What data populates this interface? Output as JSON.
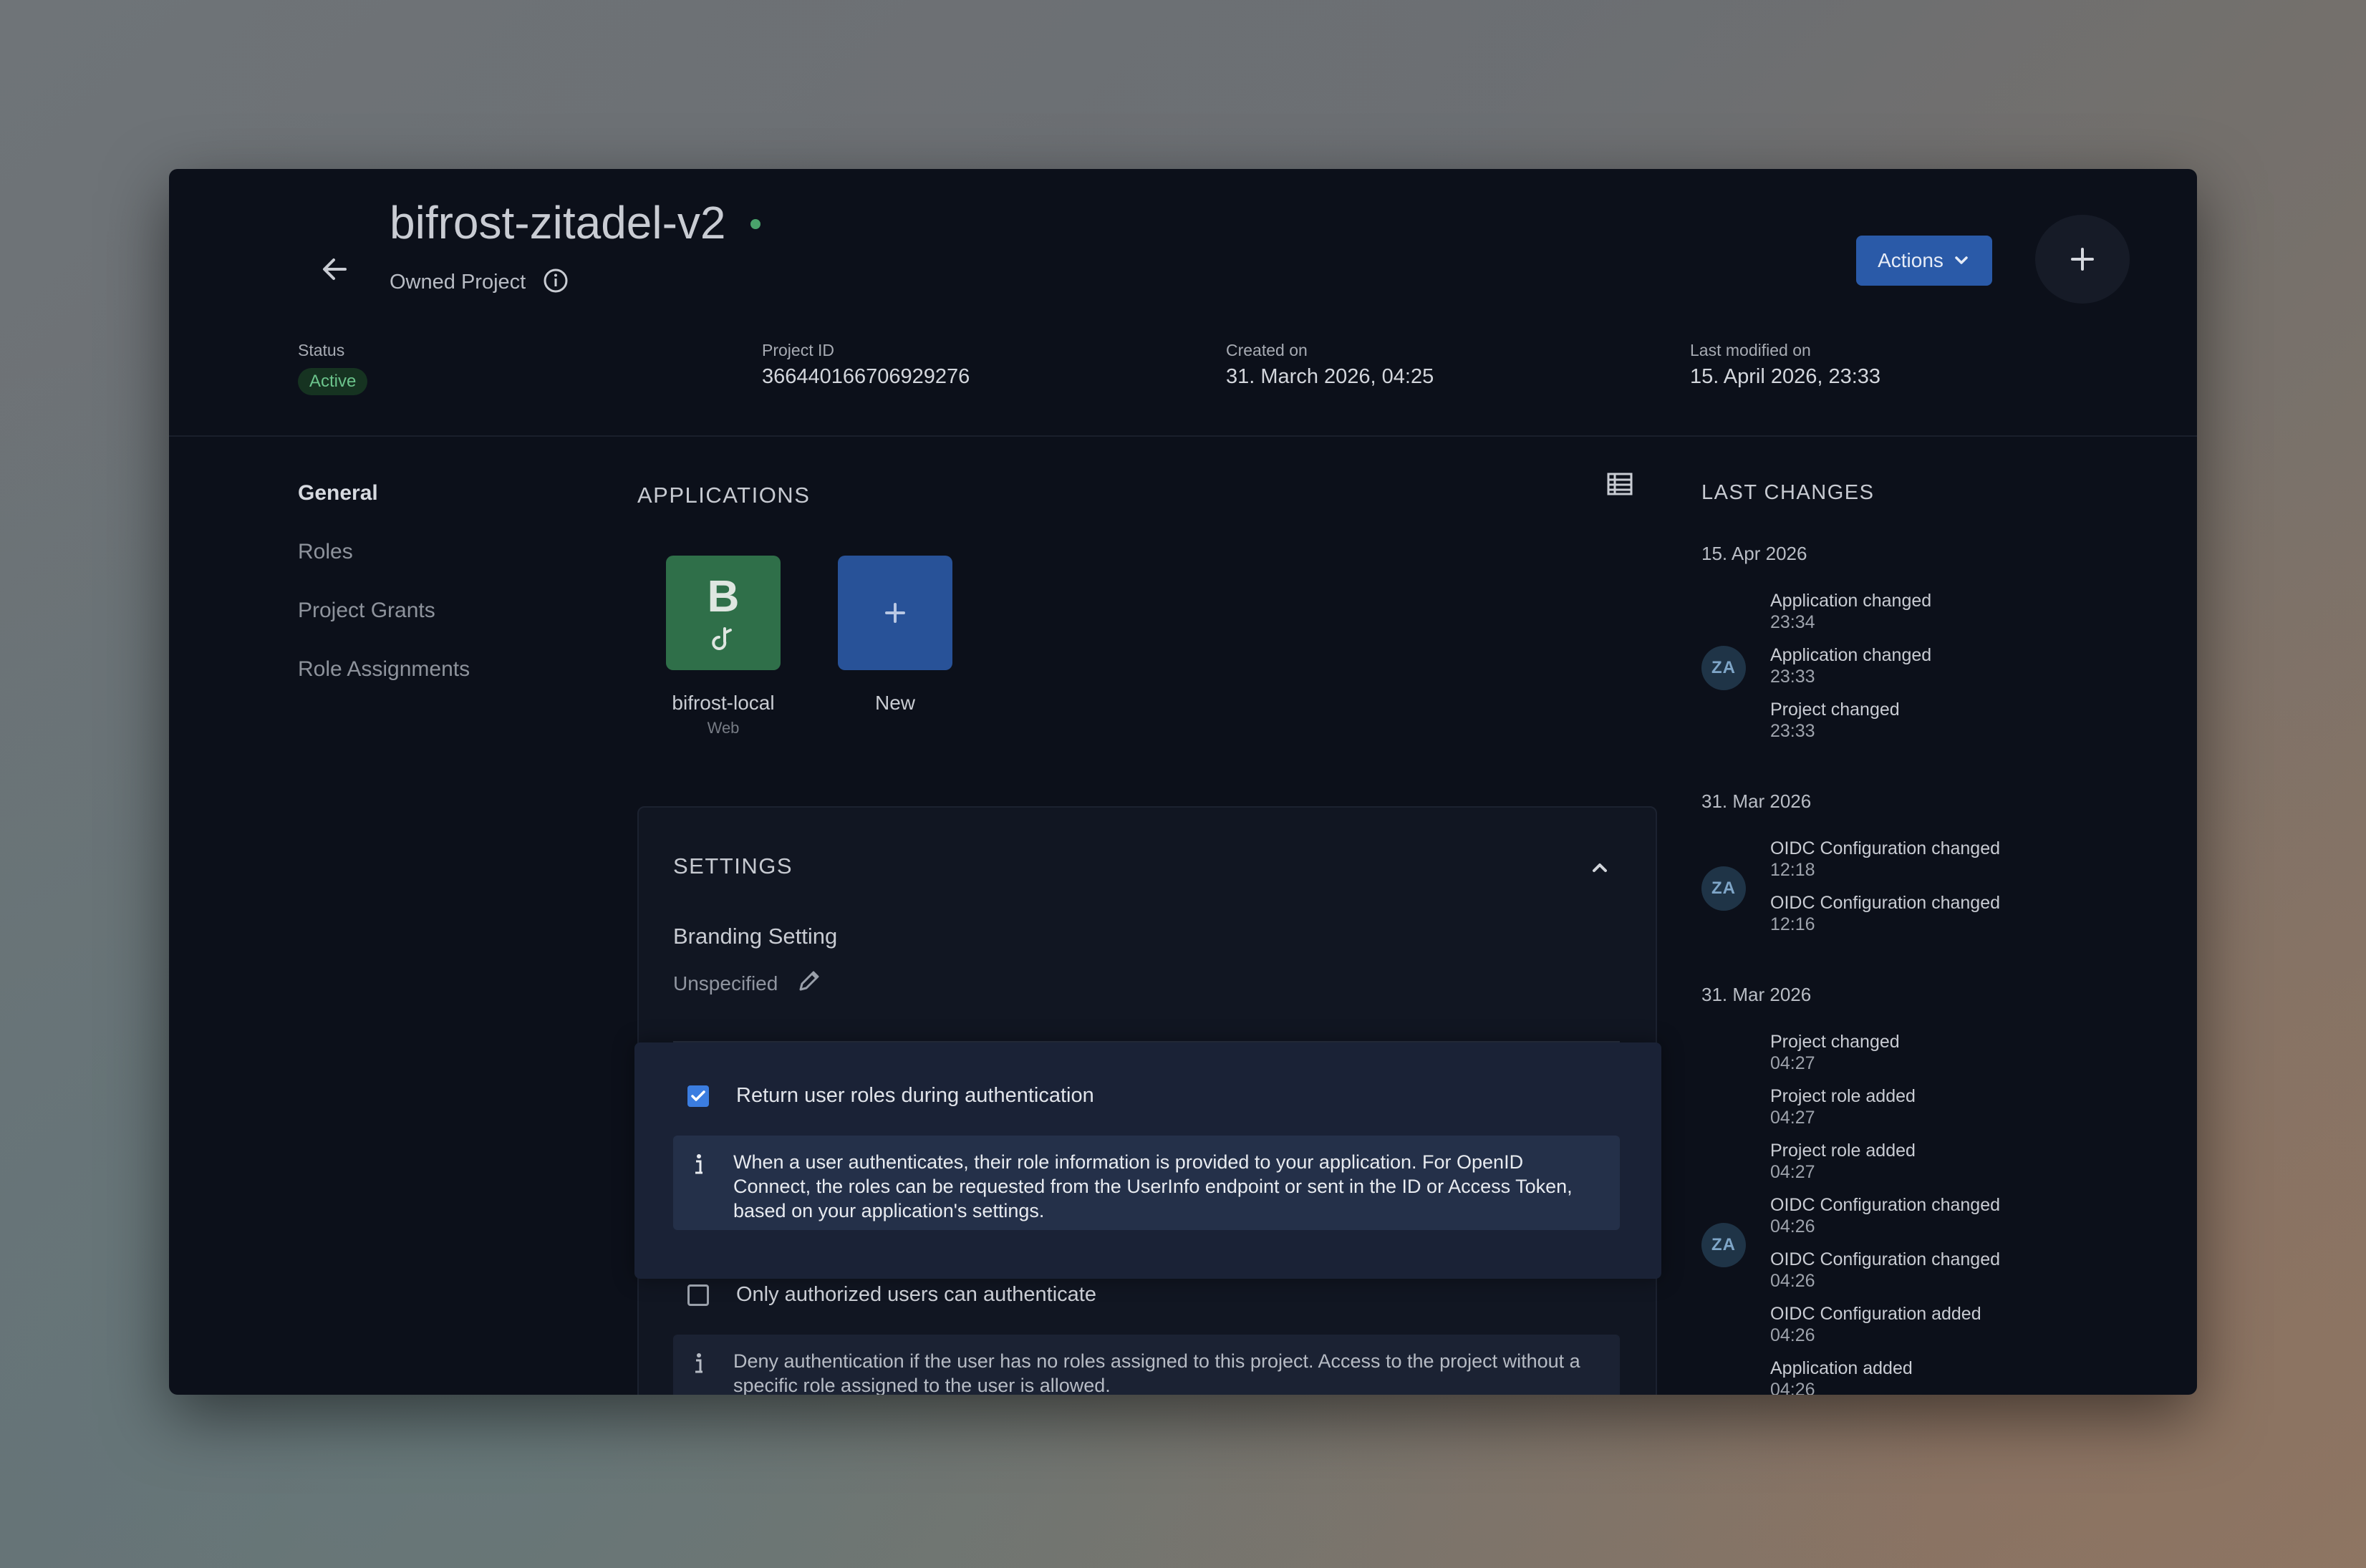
{
  "header": {
    "title": "bifrost-zitadel-v2",
    "subtitle": "Owned Project",
    "actions_label": "Actions"
  },
  "meta": {
    "status_label": "Status",
    "status_value": "Active",
    "project_id_label": "Project ID",
    "project_id_value": "366440166706929276",
    "created_label": "Created on",
    "created_value": "31. March 2026, 04:25",
    "modified_label": "Last modified on",
    "modified_value": "15. April 2026, 23:33"
  },
  "nav": {
    "items": [
      "General",
      "Roles",
      "Project Grants",
      "Role Assignments"
    ]
  },
  "applications": {
    "title": "APPLICATIONS",
    "apps": [
      {
        "letter": "B",
        "name": "bifrost-local",
        "type": "Web"
      }
    ],
    "new_label": "New"
  },
  "settings": {
    "title": "SETTINGS",
    "branding_label": "Branding Setting",
    "branding_value": "Unspecified",
    "options": [
      {
        "label": "Return user roles during authentication",
        "checked": true,
        "description": "When a user authenticates, their role information is provided to your application. For OpenID Connect, the roles can be requested from the UserInfo endpoint or sent in the ID or Access Token, based on your application's settings."
      },
      {
        "label": "Only authorized users can authenticate",
        "checked": false,
        "description": "Deny authentication if the user has no roles assigned to this project. Access to the project without a specific role assigned to the user is allowed."
      }
    ]
  },
  "last_changes": {
    "title": "LAST CHANGES",
    "groups": [
      {
        "date": "15. Apr 2026",
        "avatar": "ZA",
        "entries": [
          {
            "text": "Application changed",
            "time": "23:34"
          },
          {
            "text": "Application changed",
            "time": "23:33"
          },
          {
            "text": "Project changed",
            "time": "23:33"
          }
        ]
      },
      {
        "date": "31. Mar 2026",
        "avatar": "ZA",
        "entries": [
          {
            "text": "OIDC Configuration changed",
            "time": "12:18"
          },
          {
            "text": "OIDC Configuration changed",
            "time": "12:16"
          }
        ]
      },
      {
        "date": "31. Mar 2026",
        "avatar": "ZA",
        "entries": [
          {
            "text": "Project changed",
            "time": "04:27"
          },
          {
            "text": "Project role added",
            "time": "04:27"
          },
          {
            "text": "Project role added",
            "time": "04:27"
          },
          {
            "text": "OIDC Configuration changed",
            "time": "04:26"
          },
          {
            "text": "OIDC Configuration changed",
            "time": "04:26"
          },
          {
            "text": "OIDC Configuration added",
            "time": "04:26"
          },
          {
            "text": "Application added",
            "time": "04:26"
          }
        ]
      }
    ]
  },
  "colors": {
    "accent": "#2a5aa8",
    "status_active": "#4aa36b",
    "app_tile": "#2f6f49"
  }
}
